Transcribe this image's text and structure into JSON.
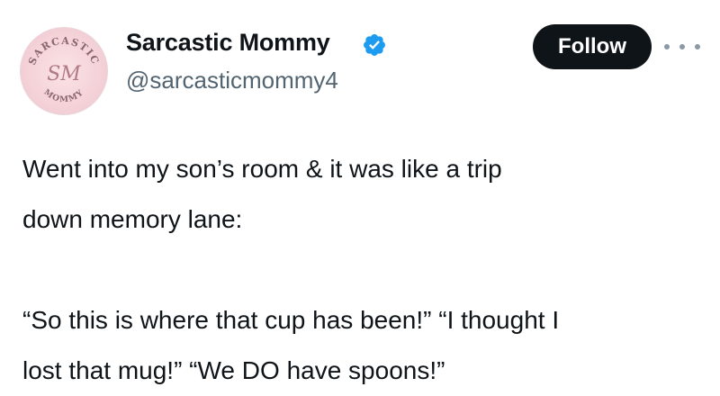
{
  "author": {
    "display_name": "Sarcastic Mommy",
    "handle": "@sarcasticmommy4",
    "verified": true,
    "avatar": {
      "ring_top": "SARCASTIC",
      "ring_bottom": "MOMMY",
      "monogram": "SM",
      "bg_color": "#f4d3d9",
      "text_color": "#b07a86"
    }
  },
  "follow_button": {
    "label": "Follow"
  },
  "more_icon": "more-horizontal-icon",
  "tweet": {
    "lines": [
      "Went into my son’s room & it was like a trip",
      "down memory lane:",
      "“So this is where that cup has been!” “I thought I",
      "lost that mug!” “We DO have spoons!”"
    ]
  },
  "colors": {
    "text": "#0f1419",
    "secondary_text": "#536471",
    "verified_blue": "#1d9bf0",
    "button_bg": "#0f1419"
  }
}
